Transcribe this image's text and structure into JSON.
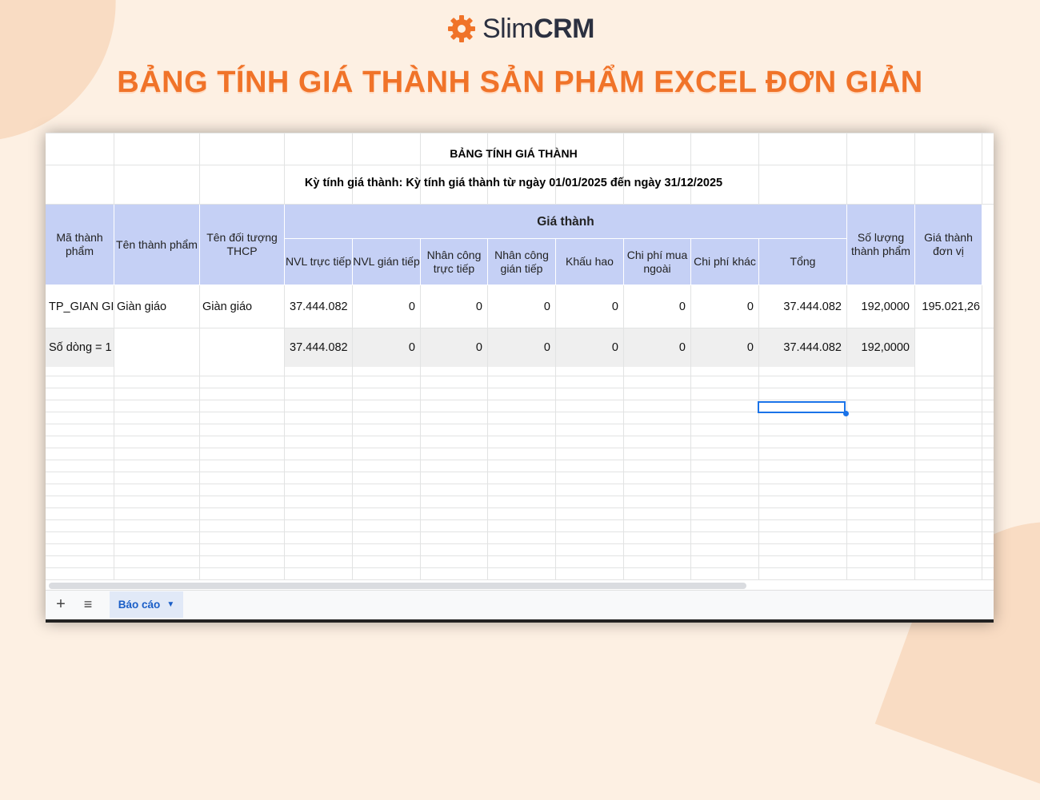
{
  "brand": {
    "name_light": "Slim",
    "name_bold": "CRM"
  },
  "headline": "BẢNG TÍNH GIÁ THÀNH SẢN PHẨM EXCEL ĐƠN GIẢN",
  "sheet": {
    "title": "BẢNG TÍNH GIÁ THÀNH",
    "period": "Kỳ tính giá thành: Kỳ tính giá thành từ ngày 01/01/2025 đến ngày 31/12/2025",
    "headers": {
      "ma_thanh_pham": "Mã thành phẩm",
      "ten_thanh_pham": "Tên thành phẩm",
      "ten_doi_tuong": "Tên đối tượng THCP",
      "gia_thanh_group": "Giá thành",
      "nvl_truc_tiep": "NVL trực tiếp",
      "nvl_gian_tiep": "NVL gián tiếp",
      "nhan_cong_truc_tiep": "Nhân công trực tiếp",
      "nhan_cong_gian_tiep": "Nhân công gián tiếp",
      "khau_hao": "Khấu hao",
      "chi_phi_mua_ngoai": "Chi phí mua ngoài",
      "chi_phi_khac": "Chi phí khác",
      "tong": "Tổng",
      "so_luong": "Số lượng thành phẩm",
      "gia_thanh_don_vi": "Giá thành đơn vị"
    },
    "rows": [
      [
        "TP_GIAN GI",
        "Giàn giáo",
        "Giàn giáo",
        "37.444.082",
        "0",
        "0",
        "0",
        "0",
        "0",
        "0",
        "37.444.082",
        "192,0000",
        "195.021,26"
      ],
      [
        "Số dòng = 1",
        "",
        "",
        "37.444.082",
        "0",
        "0",
        "0",
        "0",
        "0",
        "0",
        "37.444.082",
        "192,0000",
        ""
      ]
    ],
    "tab": {
      "label": "Báo cáo",
      "add_icon": "plus-icon",
      "list_icon": "menu-icon"
    }
  },
  "colors": {
    "headline": "#f07329",
    "header_bg": "#c5d0f5",
    "background": "#fdf0e3",
    "selection": "#1a73e8"
  }
}
